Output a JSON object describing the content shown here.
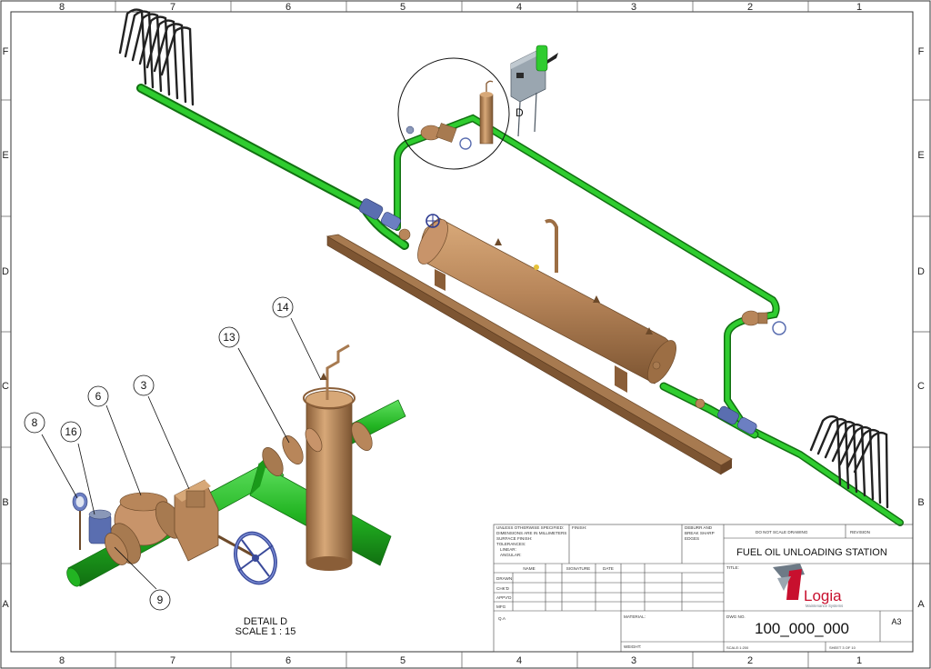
{
  "border": {
    "columns": [
      "8",
      "7",
      "6",
      "5",
      "4",
      "3",
      "2",
      "1"
    ],
    "rows": [
      "F",
      "E",
      "D",
      "C",
      "B",
      "A"
    ]
  },
  "detail": {
    "circle_label": "D",
    "title": "DETAIL D",
    "scale": "SCALE 1 : 15",
    "callouts": [
      "8",
      "16",
      "6",
      "3",
      "13",
      "14",
      "9"
    ]
  },
  "title_block": {
    "tolerance_notes": [
      "UNLESS OTHERWISE SPECIFIED:",
      "DIMENSIONS ARE IN MILLIMETERS",
      "SURFACE FINISH:",
      "TOLERANCES:",
      "LINEAR:",
      "ANGULAR:"
    ],
    "finish_label": "FINISH:",
    "deburr_notes": [
      "DEBURR AND",
      "BREAK SHARP",
      "EDGES"
    ],
    "do_not_scale": "DO NOT SCALE DRAWING",
    "revision_label": "REVISION",
    "drawing_title": "FUEL OIL UNLOADING STATION",
    "title_label": "TITLE:",
    "columns": [
      "NAME",
      "SIGNATURE",
      "DATE"
    ],
    "rows": [
      "DRAWN",
      "CHK'D",
      "APPV'D",
      "MFG",
      "Q.A"
    ],
    "material_label": "MATERIAL:",
    "weight_label": "WEIGHT:",
    "dwg_no_label": "DWG NO.",
    "dwg_no": "100_000_000",
    "sheet_size": "A3",
    "scale": "SCALE:1:200",
    "sheet": "SHEET 3 OF 10",
    "logo_text": "Logia",
    "logo_tagline": "Maintenance Systems",
    "logo_brand_color": "#c8102e",
    "logo_secondary_color": "#6d7a86"
  },
  "colors": {
    "pipe": "#22b422",
    "pipe_dark": "#137a13",
    "tank": "#b8865a",
    "tank_dark": "#8a5e38",
    "valve_blue": "#5a6eb0",
    "base": "#9c7048"
  }
}
